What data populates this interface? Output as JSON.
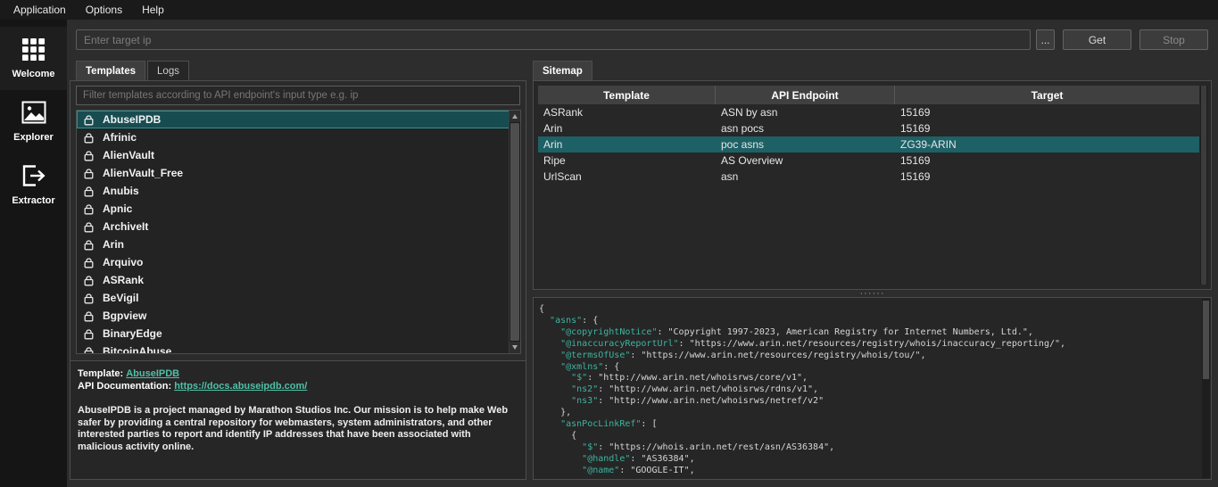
{
  "menubar": {
    "items": [
      {
        "label": "Application"
      },
      {
        "label": "Options"
      },
      {
        "label": "Help"
      }
    ]
  },
  "sidebar": {
    "items": [
      {
        "label": "Welcome",
        "icon": "grid-icon",
        "active": true
      },
      {
        "label": "Explorer",
        "icon": "image-icon",
        "active": false
      },
      {
        "label": "Extractor",
        "icon": "export-icon",
        "active": false
      }
    ]
  },
  "toolbar": {
    "target_input": {
      "value": "",
      "placeholder": "Enter target ip"
    },
    "browse_label": "...",
    "get_label": "Get",
    "stop_label": "Stop"
  },
  "left_panel": {
    "tabs": [
      {
        "label": "Templates",
        "active": true
      },
      {
        "label": "Logs",
        "active": false
      }
    ],
    "filter": {
      "value": "",
      "placeholder": "Filter templates according to API endpoint's input type e.g. ip"
    },
    "selected_template": "AbuseIPDB",
    "templates": [
      "AbuseIPDB",
      "Afrinic",
      "AlienVault",
      "AlienVault_Free",
      "Anubis",
      "Apnic",
      "ArchiveIt",
      "Arin",
      "Arquivo",
      "ASRank",
      "BeVigil",
      "Bgpview",
      "BinaryEdge",
      "BitcoinAbuse"
    ],
    "info": {
      "template_label": "Template:",
      "template_link": "AbuseIPDB",
      "api_doc_label": "API Documentation:",
      "api_doc_link": "https://docs.abuseipdb.com/",
      "description": "AbuseIPDB is a project managed by Marathon Studios Inc. Our mission is to help make Web safer by providing a central repository for webmasters, system administrators, and other interested parties to report and identify IP addresses that have been associated with malicious activity online."
    }
  },
  "right_panel": {
    "tabs": [
      {
        "label": "Sitemap",
        "active": true
      }
    ],
    "table": {
      "columns": [
        "Template",
        "API Endpoint",
        "Target"
      ],
      "rows": [
        {
          "template": "ASRank",
          "endpoint": "ASN by asn",
          "target": "15169",
          "selected": false
        },
        {
          "template": "Arin",
          "endpoint": "asn pocs",
          "target": "15169",
          "selected": false
        },
        {
          "template": "Arin",
          "endpoint": "poc asns",
          "target": "ZG39-ARIN",
          "selected": true
        },
        {
          "template": "Ripe",
          "endpoint": "AS Overview",
          "target": "15169",
          "selected": false
        },
        {
          "template": "UrlScan",
          "endpoint": "asn",
          "target": "15169",
          "selected": false
        }
      ]
    },
    "json_viewer": {
      "lines": [
        "{",
        "  \"asns\": {",
        "    \"@copyrightNotice\": \"Copyright 1997-2023, American Registry for Internet Numbers, Ltd.\",",
        "    \"@inaccuracyReportUrl\": \"https://www.arin.net/resources/registry/whois/inaccuracy_reporting/\",",
        "    \"@termsOfUse\": \"https://www.arin.net/resources/registry/whois/tou/\",",
        "    \"@xmlns\": {",
        "      \"$\": \"http://www.arin.net/whoisrws/core/v1\",",
        "      \"ns2\": \"http://www.arin.net/whoisrws/rdns/v1\",",
        "      \"ns3\": \"http://www.arin.net/whoisrws/netref/v2\"",
        "    },",
        "    \"asnPocLinkRef\": [",
        "      {",
        "        \"$\": \"https://whois.arin.net/rest/asn/AS36384\",",
        "        \"@handle\": \"AS36384\",",
        "        \"@name\": \"GOOGLE-IT\","
      ]
    }
  },
  "colors": {
    "accent": "#4fc0a8",
    "selection_bg": "#1d6166",
    "json_key": "#3fb3a0"
  }
}
